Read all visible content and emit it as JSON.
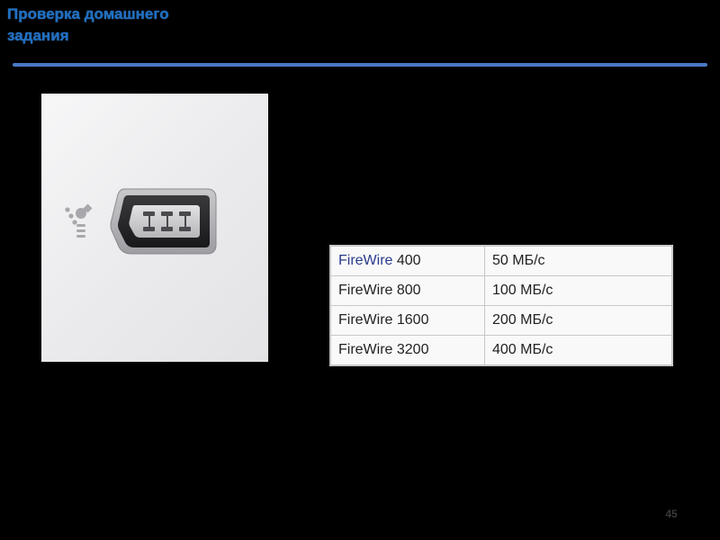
{
  "slide": {
    "title_lines": [
      "Проверка домашнего",
      "задания"
    ],
    "page_number": "45"
  },
  "photo": {
    "subject": "firewire-port",
    "icon": "firewire-logo-icon"
  },
  "table": {
    "rows": [
      {
        "interface_link": "FireWire",
        "interface_rest": " 400",
        "speed": "50 МБ/с"
      },
      {
        "interface": "FireWire 800",
        "speed": "100 МБ/с"
      },
      {
        "interface": "FireWire 1600",
        "speed": "200 МБ/с"
      },
      {
        "interface": "FireWire 3200",
        "speed": "400 МБ/с"
      }
    ]
  },
  "colors": {
    "background": "#000000",
    "title": "#1f6fc0",
    "rule": "#4a79c4",
    "table_background": "#f9f9f9",
    "table_border": "#c8c8c8",
    "link": "#2a3a8c"
  }
}
